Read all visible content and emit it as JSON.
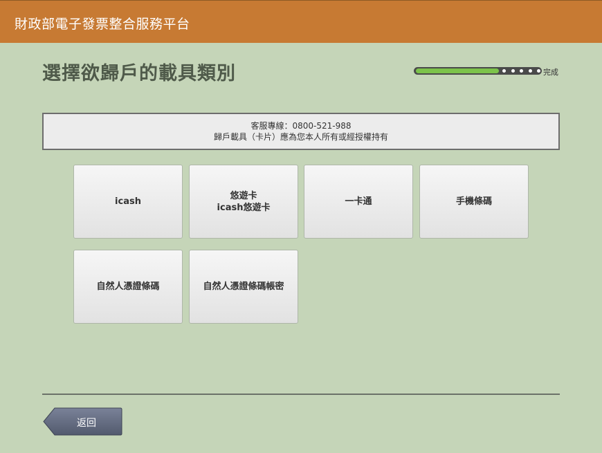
{
  "header": {
    "title": "財政部電子發票整合服務平台",
    "bg_color": "#c77a33"
  },
  "page": {
    "title": "選擇欲歸戶的載具類別"
  },
  "progress": {
    "fraction": 0.67,
    "steps_remaining": 5,
    "label": "完成",
    "fill_color": "#7cc34a"
  },
  "notice": {
    "line1": "客服專線：0800-521-988",
    "line2": "歸戶載具（卡片）應為您本人所有或經授權持有"
  },
  "carriers": [
    {
      "name": "icash-tile",
      "lines": [
        "icash"
      ]
    },
    {
      "name": "easycard-tile",
      "lines": [
        "悠遊卡",
        "icash悠遊卡"
      ]
    },
    {
      "name": "ipass-tile",
      "lines": [
        "一卡通"
      ]
    },
    {
      "name": "mobile-barcode-tile",
      "lines": [
        "手機條碼"
      ]
    },
    {
      "name": "citizen-certificate-tile",
      "lines": [
        "自然人憑證條碼"
      ]
    },
    {
      "name": "citizen-certificate-account-tile",
      "lines": [
        "自然人憑證條碼帳密"
      ]
    }
  ],
  "footer": {
    "back_label": "返回",
    "back_color": "#5c6479"
  }
}
